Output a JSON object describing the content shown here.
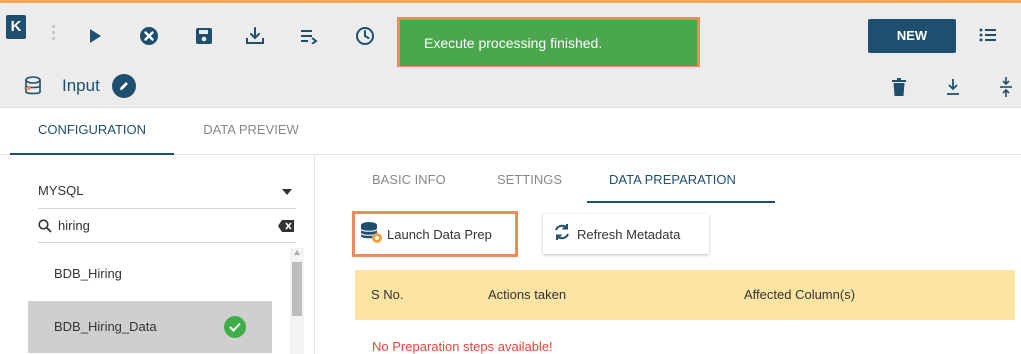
{
  "toolbar": {
    "logo_label": "K",
    "new_label": "NEW",
    "icons": [
      "play-icon",
      "stop-icon",
      "save-icon",
      "download-icon",
      "list-run-icon",
      "clock-icon",
      "list-icon"
    ]
  },
  "toast": {
    "message": "Execute processing finished."
  },
  "input_row": {
    "title": "Input",
    "icons": [
      "database-icon",
      "edit-icon",
      "trash-icon",
      "download-icon",
      "collapse-icon"
    ]
  },
  "main_tabs": [
    {
      "label": "CONFIGURATION"
    },
    {
      "label": "DATA PREVIEW"
    }
  ],
  "left": {
    "db_type": "MYSQL",
    "search_value": "hiring",
    "items": [
      {
        "label": "BDB_Hiring"
      },
      {
        "label": "BDB_Hiring_Data"
      }
    ]
  },
  "sub_tabs": [
    {
      "label": "BASIC INFO"
    },
    {
      "label": "SETTINGS"
    },
    {
      "label": "DATA PREPARATION"
    }
  ],
  "buttons": {
    "launch": "Launch Data Prep",
    "refresh": "Refresh Metadata"
  },
  "table": {
    "headers": [
      "S No.",
      "Actions taken",
      "Affected Column(s)"
    ],
    "empty": "No Preparation steps available!"
  },
  "colors": {
    "primary": "#1e4f6f",
    "toast": "#4aa74e",
    "highlight": "#f08a5d",
    "table_header": "#fde4a3",
    "error": "#e2483c"
  }
}
